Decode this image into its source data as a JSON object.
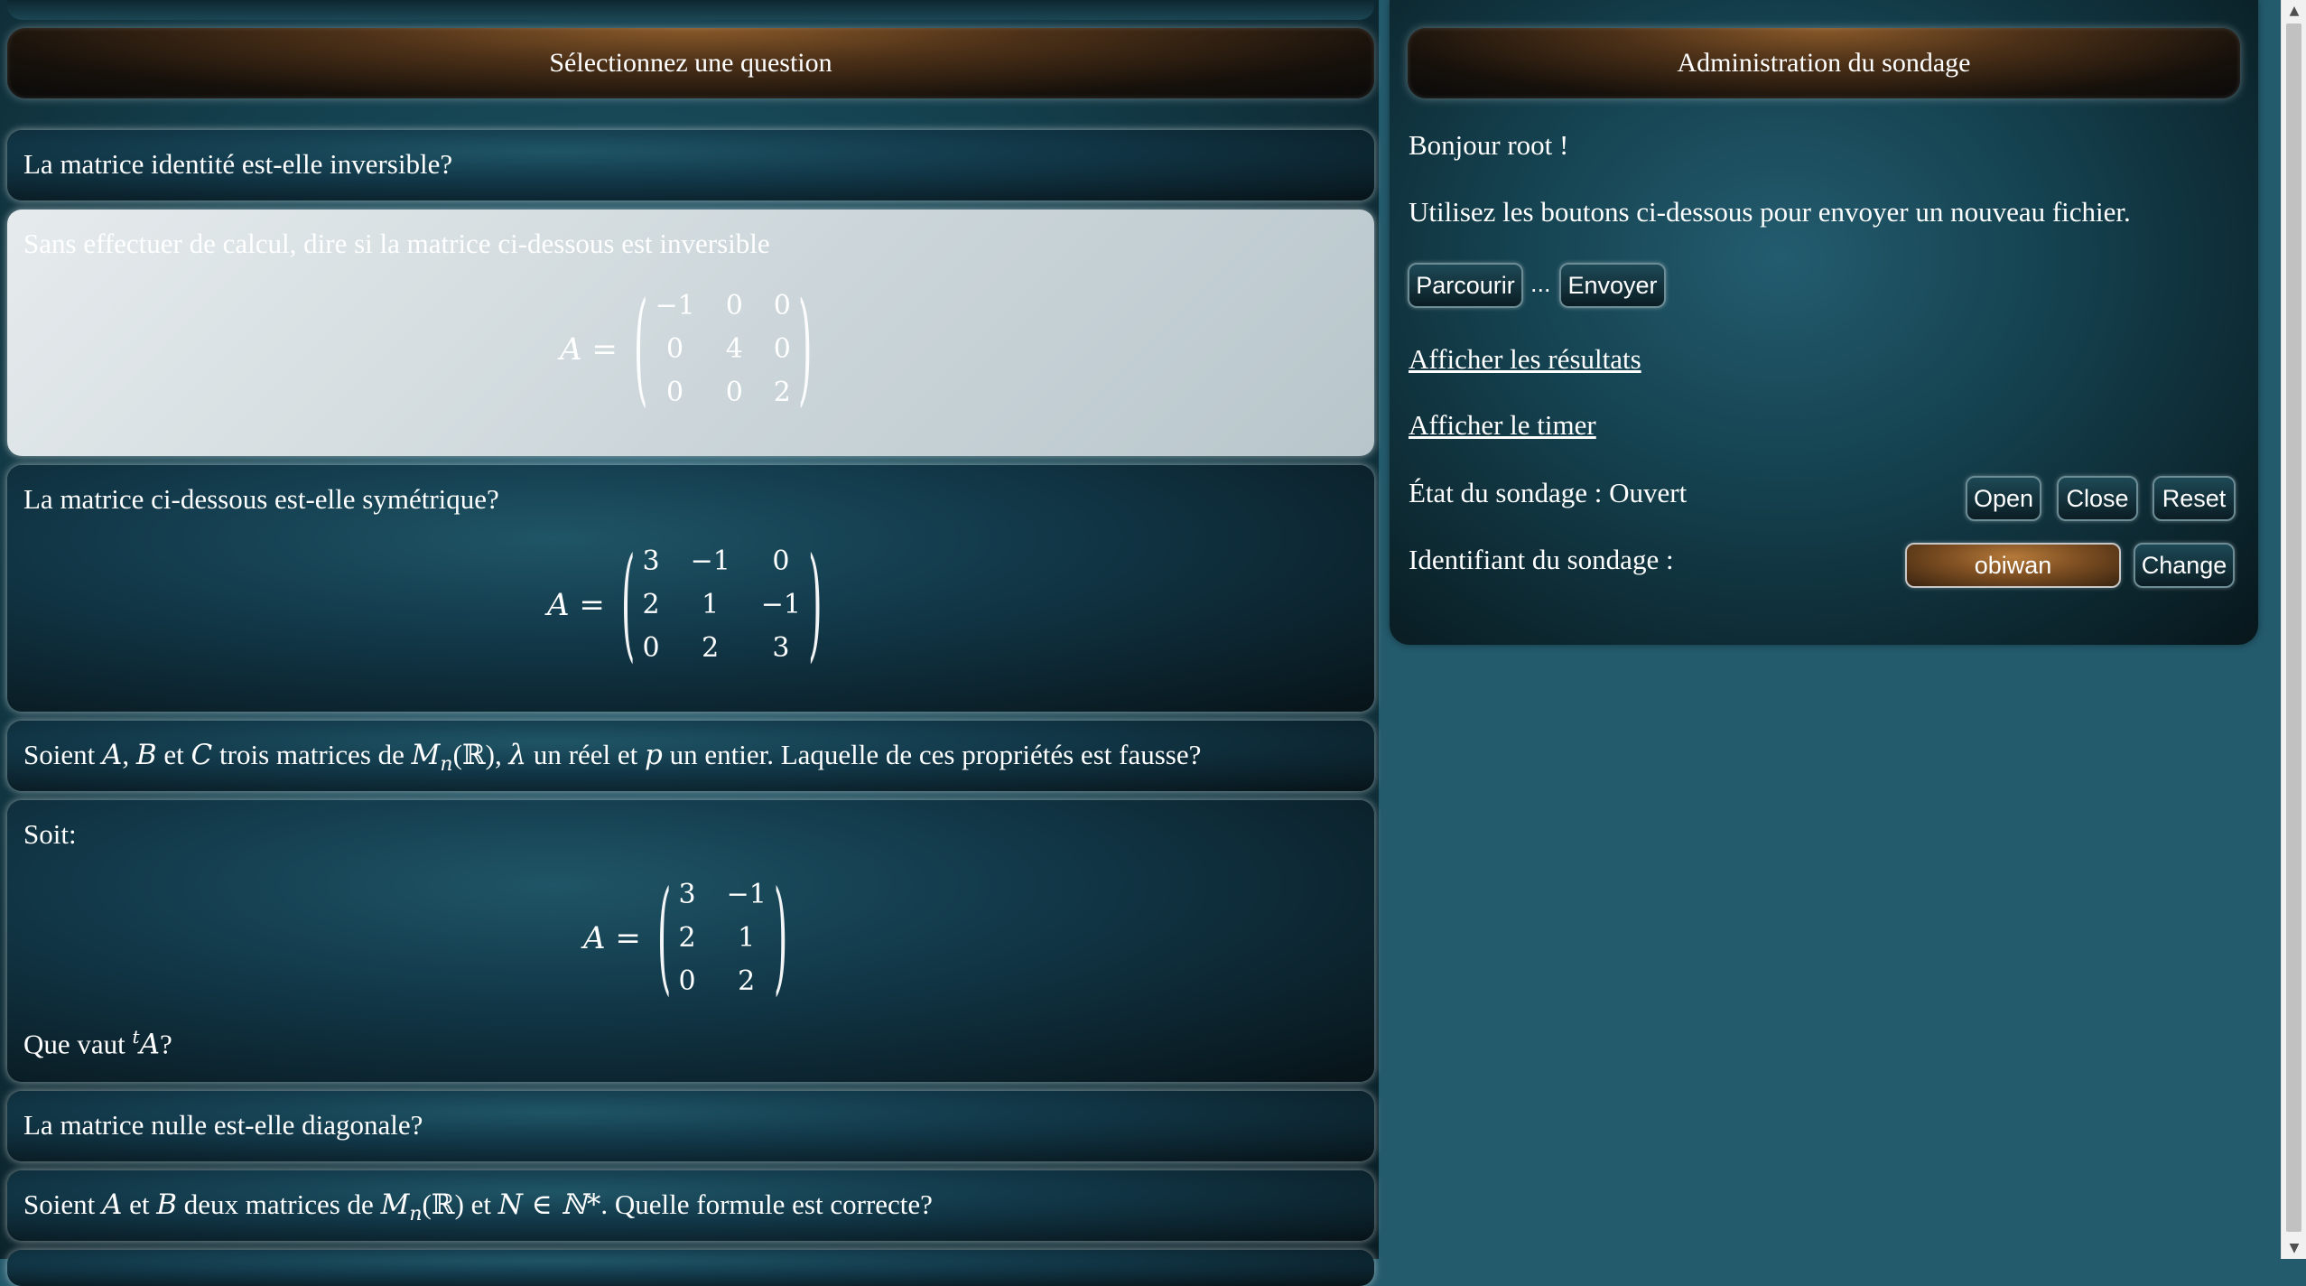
{
  "left": {
    "header": "Sélectionnez une question",
    "questions": [
      {
        "text": "La matrice identité est-elle inversible?"
      },
      {
        "text": "Sans effectuer de calcul, dire si la matrice ci-dessous est inversible",
        "matrix_label": "A =",
        "matrix": [
          [
            "−1",
            "0",
            "0"
          ],
          [
            "0",
            "4",
            "0"
          ],
          [
            "0",
            "0",
            "2"
          ]
        ]
      },
      {
        "text": "La matrice ci-dessous est-elle symétrique?",
        "matrix_label": "A =",
        "matrix": [
          [
            "3",
            "−1",
            "0"
          ],
          [
            "2",
            "1",
            "−1"
          ],
          [
            "0",
            "2",
            "3"
          ]
        ]
      },
      {
        "text_parts": [
          "Soient ",
          "A",
          ", ",
          "B",
          " et ",
          "C",
          " trois matrices de ",
          "M",
          "n",
          "(ℝ), ",
          "λ",
          " un réel et ",
          "p",
          " un entier. Laquelle de ces propriétés est fausse?"
        ]
      },
      {
        "text": "Soit:",
        "matrix_label": "A =",
        "matrix": [
          [
            "3",
            "−1"
          ],
          [
            "2",
            "1"
          ],
          [
            "0",
            "2"
          ]
        ],
        "text_after_parts": [
          "Que vaut ",
          "t",
          "A",
          "?"
        ]
      },
      {
        "text": "La matrice nulle est-elle diagonale?"
      },
      {
        "text_parts": [
          "Soient ",
          "A",
          " et ",
          "B",
          " deux matrices de ",
          "M",
          "n",
          "(ℝ)",
          " et ",
          "N ∈ ℕ*",
          ". Quelle formule est correcte?"
        ]
      }
    ]
  },
  "right": {
    "header": "Administration du sondage",
    "greeting": "Bonjour root !",
    "upload_hint": "Utilisez les boutons ci-dessous pour envoyer un nouveau fichier.",
    "browse_button": "Parcourir",
    "file_name": "...",
    "send_button": "Envoyer",
    "results_link": "Afficher les résultats",
    "timer_link": "Afficher le timer",
    "state_label": "État du sondage : Ouvert",
    "open_button": "Open",
    "close_button": "Close",
    "reset_button": "Reset",
    "id_label": "Identifiant du sondage :",
    "id_value": "obiwan",
    "change_button": "Change"
  },
  "colors": {
    "background": "#235a6c",
    "header_accent": "#8a5a2a",
    "selected_card": "#d5dde0"
  },
  "scrollbar": {
    "up_icon": "scroll-up-icon",
    "down_icon": "scroll-down-icon"
  }
}
